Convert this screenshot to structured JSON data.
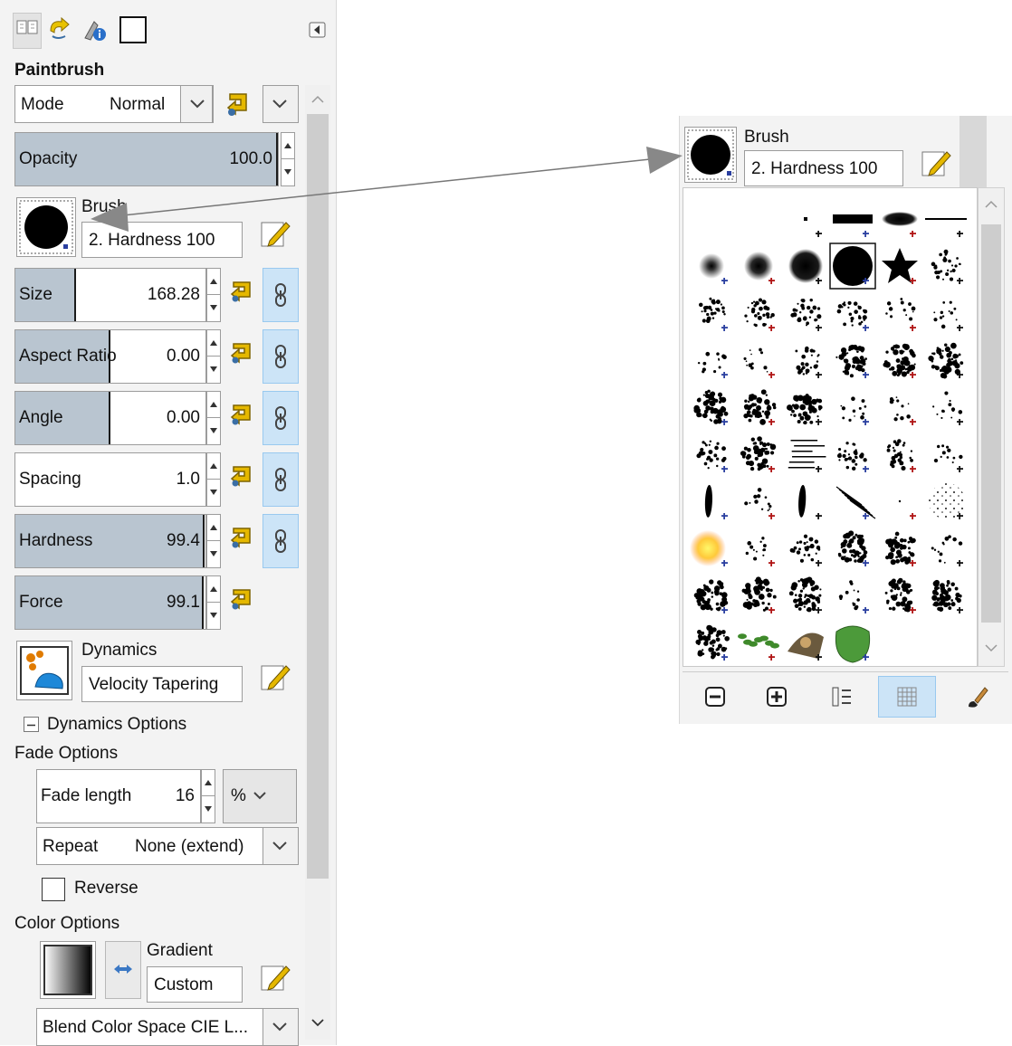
{
  "tool_options": {
    "tabs": [
      {
        "name": "tool-options-icon"
      },
      {
        "name": "undo-history-icon"
      },
      {
        "name": "pointer-info-icon"
      },
      {
        "name": "images-icon"
      }
    ],
    "title": "Paintbrush",
    "mode": {
      "label": "Mode",
      "value": "Normal"
    },
    "opacity": {
      "label": "Opacity",
      "value": "100.0",
      "fraction": 1.0
    },
    "brush": {
      "label": "Brush",
      "name": "2. Hardness 100"
    },
    "size": {
      "label": "Size",
      "value": "168.28",
      "fraction": 0.32
    },
    "aspect_ratio": {
      "label": "Aspect Ratio",
      "value": "0.00",
      "fraction": 0.5
    },
    "angle": {
      "label": "Angle",
      "value": "0.00",
      "fraction": 0.5
    },
    "spacing": {
      "label": "Spacing",
      "value": "1.0",
      "fraction": 0.0
    },
    "hardness": {
      "label": "Hardness",
      "value": "99.4",
      "fraction": 0.994
    },
    "force": {
      "label": "Force",
      "value": "99.1",
      "fraction": 0.991
    },
    "dynamics": {
      "label": "Dynamics",
      "name": "Velocity Tapering"
    },
    "dynamics_options": {
      "label": "Dynamics Options"
    },
    "fade_options": {
      "label": "Fade Options",
      "fade_length": {
        "label": "Fade length",
        "value": "16",
        "unit": "%"
      },
      "repeat": {
        "label": "Repeat",
        "value": "None (extend)"
      },
      "reverse": {
        "label": "Reverse",
        "checked": false
      }
    },
    "color_options": {
      "label": "Color Options",
      "gradient": {
        "label": "Gradient",
        "name": "Custom"
      },
      "blend_color_space": "Blend Color Space CIE L..."
    }
  },
  "brush_popup": {
    "label": "Brush",
    "name": "2. Hardness 100",
    "selected_index": 9,
    "toolbar": [
      {
        "name": "zoom-out-icon"
      },
      {
        "name": "zoom-in-icon"
      },
      {
        "name": "list-view-icon"
      },
      {
        "name": "grid-view-icon",
        "selected": true
      },
      {
        "name": "edit-brush-icon"
      }
    ]
  },
  "colors": {
    "slider_fill": "#b9c5d0",
    "chain_button_bg": "#cce4f7",
    "selection_blue": "#99c9ef",
    "reset_icon_yellow": "#e5b800"
  }
}
